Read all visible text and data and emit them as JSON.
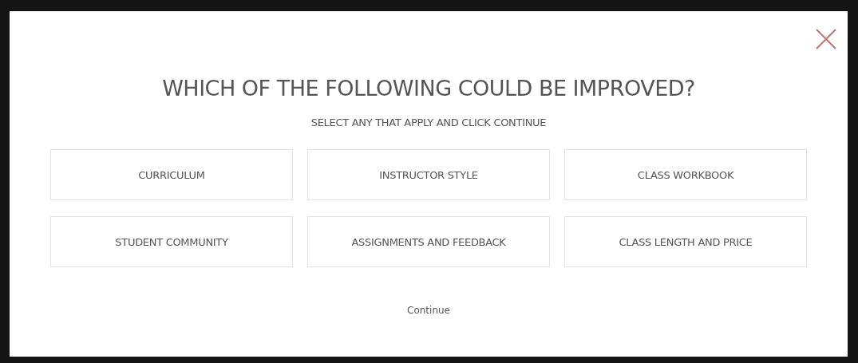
{
  "dialog": {
    "title": "WHICH OF THE FOLLOWING COULD BE IMPROVED?",
    "subtitle": "SELECT ANY THAT APPLY AND CLICK CONTINUE",
    "options": [
      {
        "label": "CURRICULUM",
        "selected": false
      },
      {
        "label": "INSTRUCTOR STYLE",
        "selected": false
      },
      {
        "label": "CLASS WORKBOOK",
        "selected": false
      },
      {
        "label": "STUDENT COMMUNITY",
        "selected": false
      },
      {
        "label": "ASSIGNMENTS AND FEEDBACK",
        "selected": false
      },
      {
        "label": "CLASS LENGTH AND PRICE",
        "selected": false
      }
    ],
    "continue": "Continue"
  }
}
